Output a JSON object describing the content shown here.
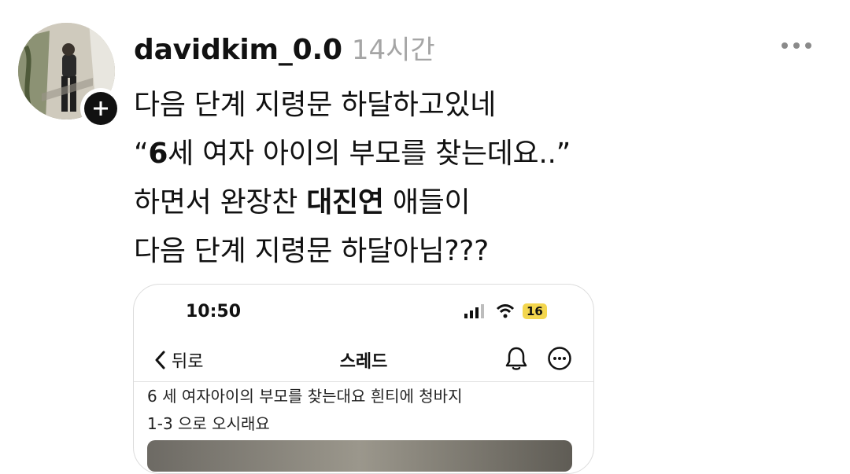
{
  "post": {
    "username": "davidkim_0.0",
    "time": "14시간",
    "lines": [
      {
        "pre": "다음 단계 지령문 하달하고있네",
        "bold": "",
        "post": ""
      },
      {
        "pre": "“",
        "bold": "6",
        "post": "세 여자 아이의 부모를 찾는데요..”"
      },
      {
        "pre": "하면서 완장찬 ",
        "bold": "대진연",
        "post": " 애들이"
      },
      {
        "pre": "다음 단계 지령문 하달아님???",
        "bold": "",
        "post": ""
      }
    ],
    "icons": {
      "avatar": "avatar-photo",
      "follow": "plus-icon",
      "more": "more-horizontal-icon"
    }
  },
  "embedded_screenshot": {
    "status_time": "10:50",
    "battery": "16",
    "back_label": "뒤로",
    "title": "스레드",
    "text_line1": "6 세 여자아이의 부모를 찾는대요 흰티에 청바지",
    "text_line2": "1-3 으로 오시래요",
    "colors": {
      "battery": "#f3d64e"
    }
  }
}
